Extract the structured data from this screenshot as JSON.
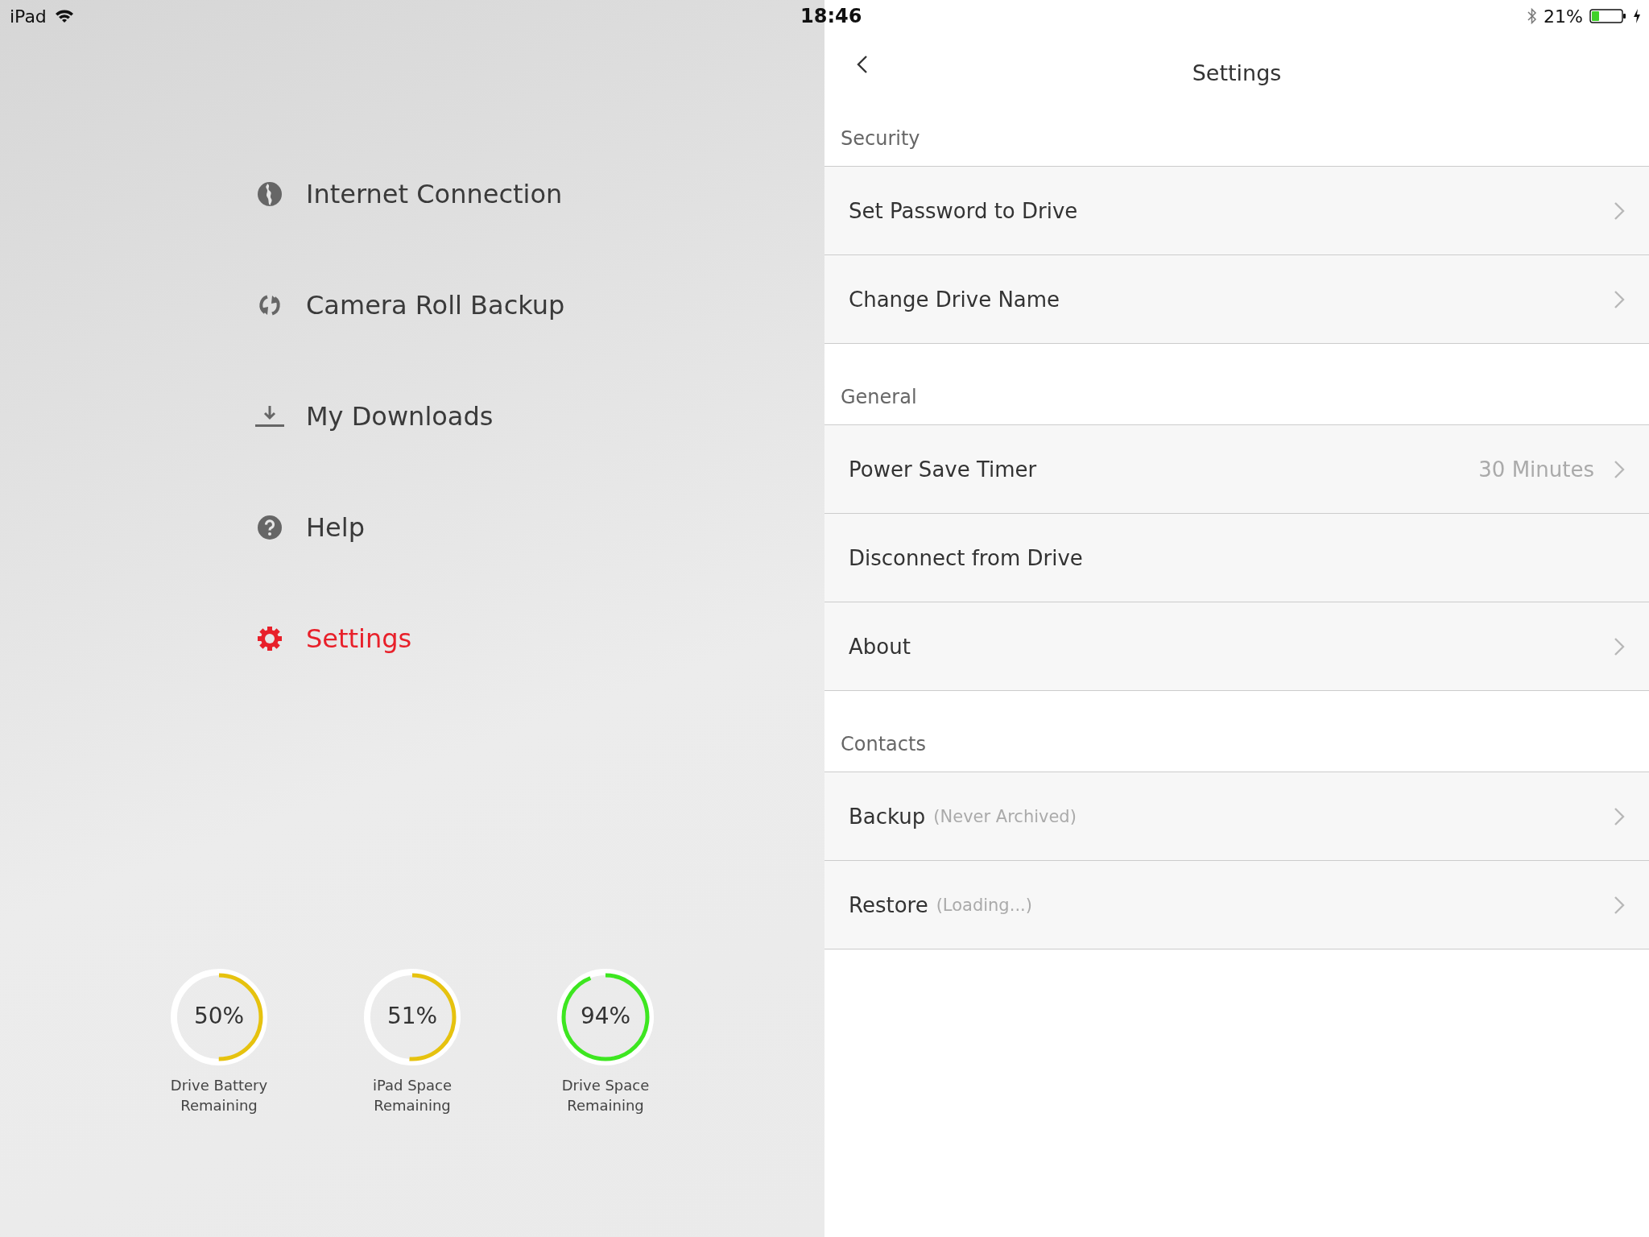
{
  "status_bar": {
    "device": "iPad",
    "time": "18:46",
    "battery_percent": "21%"
  },
  "menu": [
    {
      "kind": "globe",
      "label": "Internet Connection",
      "selected": false
    },
    {
      "kind": "sync",
      "label": "Camera Roll Backup",
      "selected": false
    },
    {
      "kind": "download",
      "label": "My Downloads",
      "selected": false
    },
    {
      "kind": "help",
      "label": "Help",
      "selected": false
    },
    {
      "kind": "settings",
      "label": "Settings",
      "selected": true
    }
  ],
  "gauges": [
    {
      "value": "50%",
      "label": "Drive Battery Remaining",
      "level": 0.5,
      "color": "#e6c20e"
    },
    {
      "value": "51%",
      "label": "iPad Space Remaining",
      "level": 0.51,
      "color": "#e6c20e"
    },
    {
      "value": "94%",
      "label": "Drive Space Remaining",
      "level": 0.94,
      "color": "#3de620"
    }
  ],
  "header": {
    "title": "Settings"
  },
  "sections": [
    {
      "title": "Security",
      "rows": [
        {
          "label": "Set Password to Drive",
          "chevron": true
        },
        {
          "label": "Change Drive Name",
          "chevron": true
        }
      ]
    },
    {
      "title": "General",
      "rows": [
        {
          "label": "Power Save Timer",
          "value": "30 Minutes",
          "chevron": true
        },
        {
          "label": "Disconnect from Drive",
          "chevron": false
        },
        {
          "label": "About",
          "chevron": true
        }
      ]
    },
    {
      "title": "Contacts",
      "rows": [
        {
          "label": "Backup",
          "note": "(Never Archived)",
          "chevron": true
        },
        {
          "label": "Restore",
          "note": "(Loading...)",
          "chevron": true
        }
      ]
    }
  ]
}
